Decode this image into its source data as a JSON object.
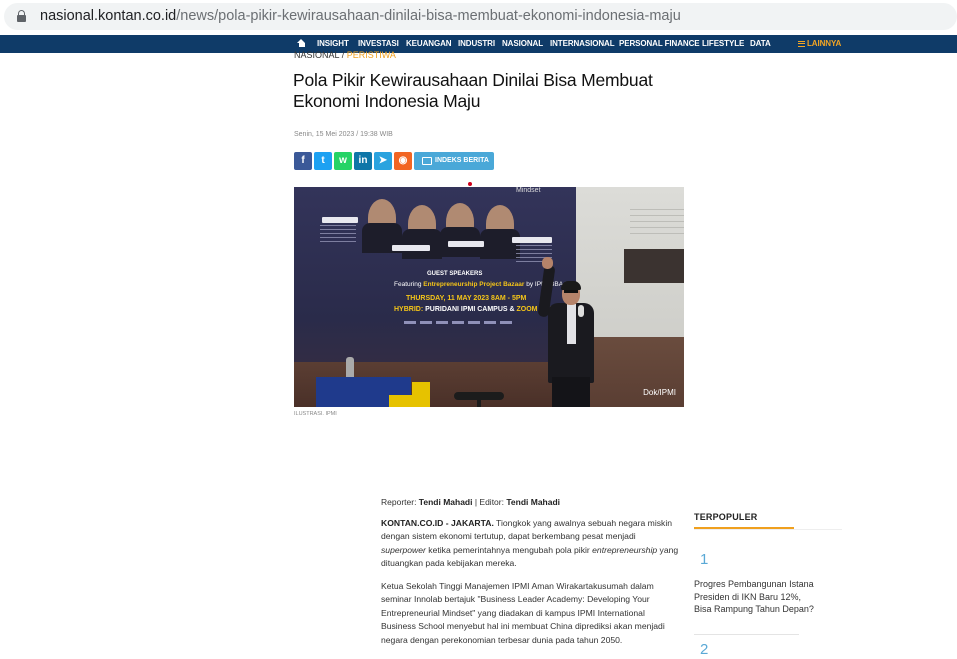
{
  "browser": {
    "url_host": "nasional.kontan.co.id",
    "url_path": "/news/pola-pikir-kewirausahaan-dinilai-bisa-membuat-ekonomi-indonesia-maju"
  },
  "nav": {
    "items": [
      "INSIGHT",
      "INVESTASI",
      "KEUANGAN",
      "INDUSTRI",
      "NASIONAL",
      "INTERNASIONAL",
      "PERSONAL FINANCE",
      "LIFESTYLE",
      "DATA"
    ],
    "more": "LAINNYA"
  },
  "article": {
    "category": "NASIONAL",
    "separator": " / ",
    "subcategory": "PERISTIWA",
    "title": "Pola Pikir Kewirausahaan Dinilai Bisa Membuat Ekonomi Indonesia Maju",
    "date": "Senin, 15 Mei 2023 / 19:38 WIB",
    "share": {
      "facebook": "f",
      "twitter": "t",
      "whatsapp": "w",
      "linkedin": "in",
      "telegram": "➤",
      "rss": "◉",
      "indeks_label": "INDEKS BERITA"
    },
    "image": {
      "credit": "Dok/IPMI",
      "caption": "ILUSTRASI. IPMI",
      "banner": {
        "mindset": "Mindset",
        "guest_speakers": "GUEST SPEAKERS",
        "featuring": "Featuring",
        "featuring_bold": "Entrepreneurship Project Bazaar",
        "featuring_tail": " by IPMI BBA Students",
        "date_line": "THURSDAY, 11 MAY 2023 8AM - 5PM",
        "hybrid_label": "HYBRID:",
        "hybrid_text": " PURIDANI IPMI CAMPUS & ",
        "hybrid_zoom": "ZOOM ONLINE"
      }
    },
    "reporter_label": "Reporter: ",
    "reporter_name": "Tendi Mahadi",
    "editor_label": " | Editor: ",
    "editor_name": "Tendi Mahadi",
    "p1_lead": "KONTAN.CO.ID - JAKARTA.",
    "p1_a": " Tiongkok yang awalnya sebuah negara miskin dengan sistem ekonomi tertutup, dapat berkembang pesat menjadi ",
    "p1_em1": "superpower",
    "p1_b": " ketika pemerintahnya mengubah pola pikir ",
    "p1_em2": "entrepreneurship",
    "p1_c": " yang dituangkan pada kebijakan mereka.",
    "p2": "Ketua Sekolah Tinggi Manajemen IPMI Aman Wirakartakusumah dalam seminar Innolab bertajuk \"Business Leader Academy: Developing Your Entrepreneurial Mindset\" yang diadakan di kampus IPMI International Business School menyebut hal ini membuat China diprediksi akan menjadi negara dengan perekonomian terbesar dunia pada tahun 2050."
  },
  "sidebar": {
    "heading": "TERPOPULER",
    "items": [
      {
        "rank": "1",
        "title": "Progres Pembangunan Istana Presiden di IKN Baru 12%, Bisa Rampung Tahun Depan?"
      },
      {
        "rank": "2",
        "title": ""
      }
    ]
  },
  "colors": {
    "nav_bg": "#0f3b68",
    "accent": "#f0a01e",
    "link_blue": "#5aa9d6"
  }
}
